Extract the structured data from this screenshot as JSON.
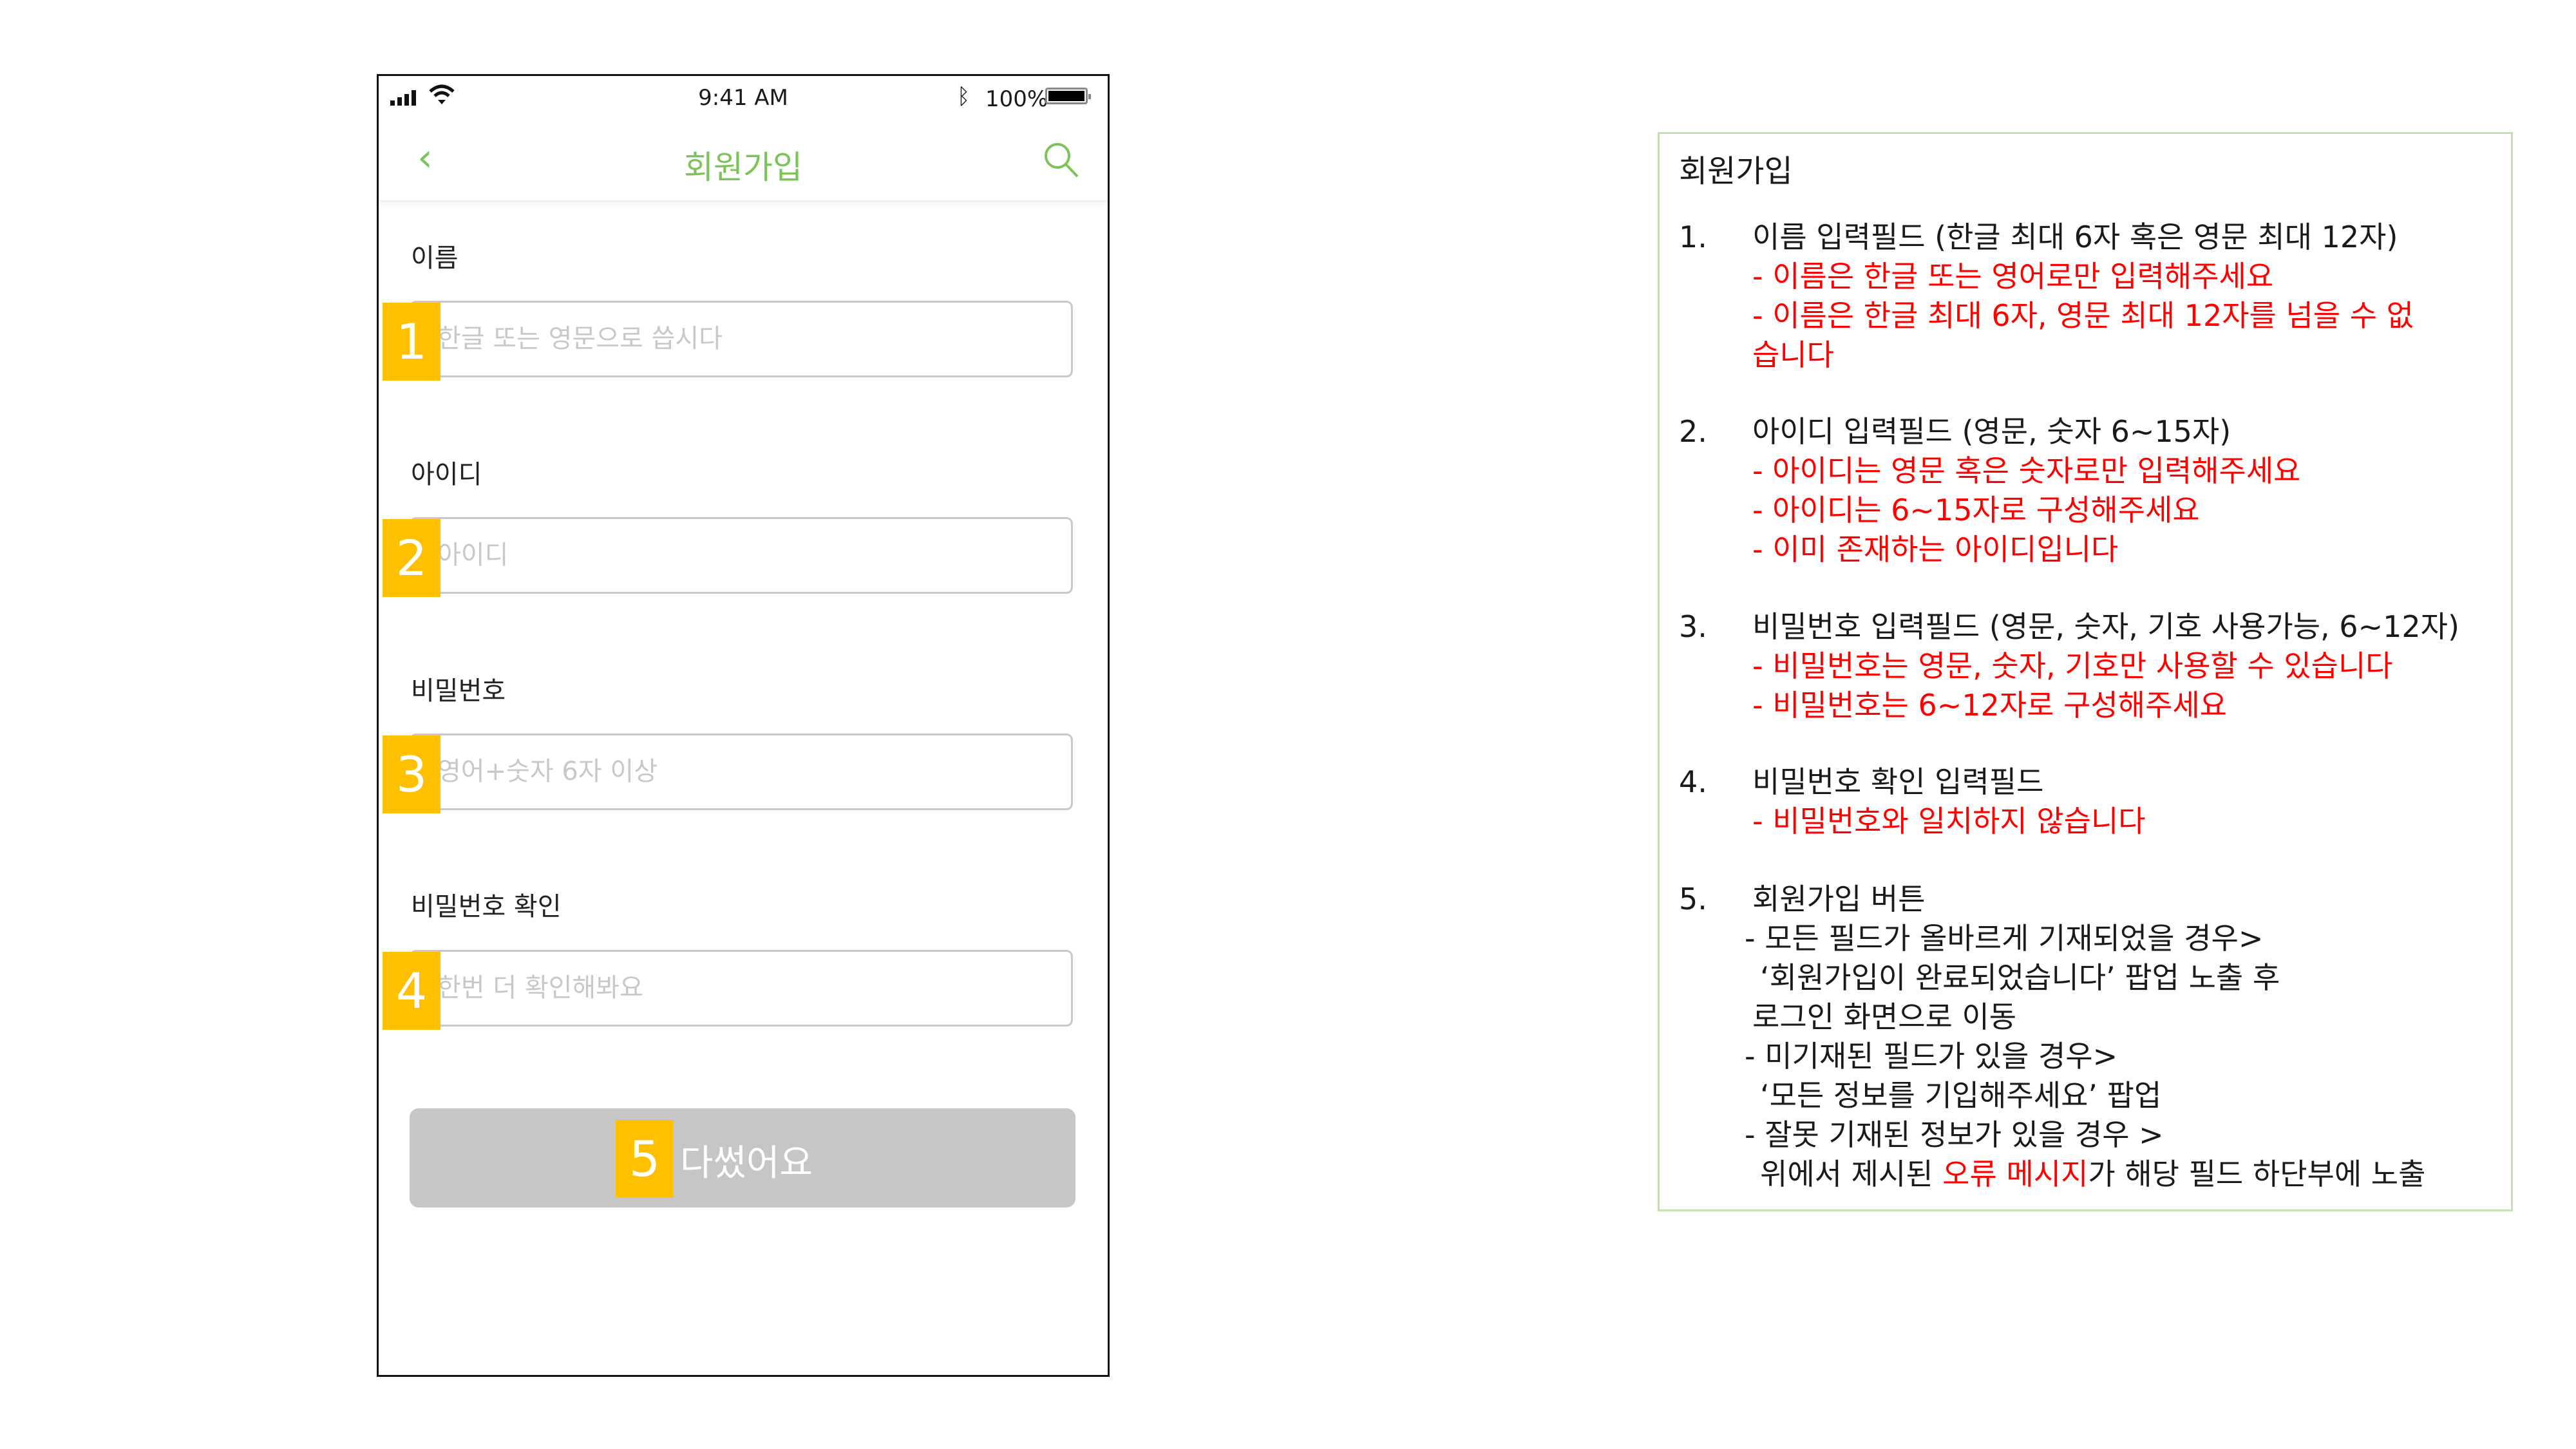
{
  "status_bar": {
    "time": "9:41 AM",
    "battery": "100%",
    "icons": [
      "signal-icon",
      "wifi-icon",
      "bluetooth-icon",
      "battery-icon"
    ]
  },
  "nav": {
    "title": "회원가입",
    "back_icon": "chevron-left-icon",
    "search_icon": "search-icon"
  },
  "form": {
    "fields": [
      {
        "label": "이름",
        "placeholder": "한글 또는 영문으로 씁시다",
        "badge": "1"
      },
      {
        "label": "아이디",
        "placeholder": "아이디",
        "badge": "2"
      },
      {
        "label": "비밀번호",
        "placeholder": "영어+숫자 6자 이상",
        "badge": "3"
      },
      {
        "label": "비밀번호 확인",
        "placeholder": "한번 더 확인해봐요",
        "badge": "4"
      }
    ],
    "submit": {
      "label": "다썼어요",
      "badge": "5"
    }
  },
  "colors": {
    "accent": "#7cc35a",
    "badge": "#ffc000",
    "error": "#ff0000",
    "panel_border": "#c6e0b4"
  },
  "spec": {
    "title": "회원가입",
    "items": [
      {
        "num": "1.",
        "heading": "이름 입력필드 (한글 최대 6자 혹은 영문 최대 12자)",
        "errors": [
          "- 이름은 한글 또는 영어로만 입력해주세요",
          "- 이름은 한글 최대 6자, 영문 최대 12자를 넘을 수 없습니다"
        ]
      },
      {
        "num": "2.",
        "heading": "아이디 입력필드 (영문, 숫자 6~15자)",
        "errors": [
          "- 아이디는 영문 혹은 숫자로만 입력해주세요",
          "- 아이디는 6~15자로 구성해주세요",
          "- 이미 존재하는 아이디입니다"
        ]
      },
      {
        "num": "3.",
        "heading": "비밀번호 입력필드 (영문, 숫자, 기호 사용가능, 6~12자)",
        "errors": [
          "- 비밀번호는 영문, 숫자, 기호만 사용할 수 있습니다",
          "- 비밀번호는 6~12자로 구성해주세요"
        ]
      },
      {
        "num": "4.",
        "heading": "비밀번호 확인 입력필드",
        "errors": [
          "- 비밀번호와 일치하지 않습니다"
        ]
      },
      {
        "num": "5.",
        "heading": "회원가입 버튼",
        "lines": [
          "- 모든 필드가 올바르게 기재되었을 경우>",
          "‘회원가입이 완료되었습니다’ 팝업 노출 후",
          "로그인 화면으로 이동",
          "- 미기재된 필드가 있을 경우>",
          "‘모든 정보를 기입해주세요’ 팝업",
          "- 잘못 기재된 정보가 있을 경우 >"
        ],
        "last_line": {
          "before": "위에서 제시된 ",
          "highlight": "오류 메시지",
          "after": "가 해당 필드 하단부에 노출"
        }
      }
    ]
  }
}
